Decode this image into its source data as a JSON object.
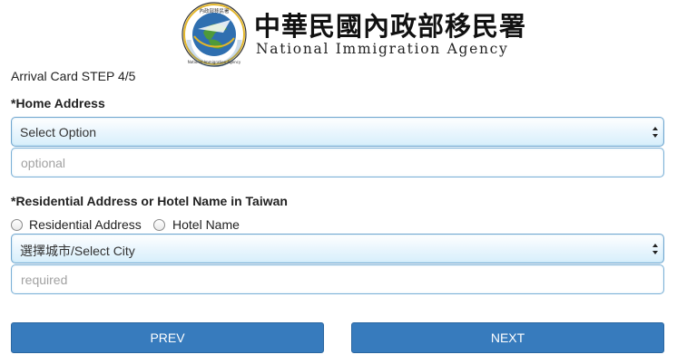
{
  "header": {
    "agency_name_zh": "中華民國內政部移民署",
    "agency_name_en": "National Immigration Agency",
    "logo_text_top": "內政部移民署",
    "logo_text_ring": "National Immigration Agency"
  },
  "step_label": "Arrival Card STEP 4/5",
  "home_address": {
    "label": "*Home Address",
    "select_value": "Select Option",
    "input_placeholder": "optional"
  },
  "residential": {
    "label": "*Residential Address or Hotel Name in Taiwan",
    "radio_options": [
      {
        "label": "Residential Address",
        "selected": false
      },
      {
        "label": "Hotel Name",
        "selected": false
      }
    ],
    "city_select_value": "選擇城市/Select City",
    "input_placeholder": "required"
  },
  "buttons": {
    "prev": "PREV",
    "next": "NEXT"
  },
  "colors": {
    "button_bg": "#377bbd",
    "field_border": "#6fa6cf",
    "logo_blue": "#2f6fb0",
    "logo_green": "#4f9a3a",
    "logo_gold": "#e3b62a"
  }
}
